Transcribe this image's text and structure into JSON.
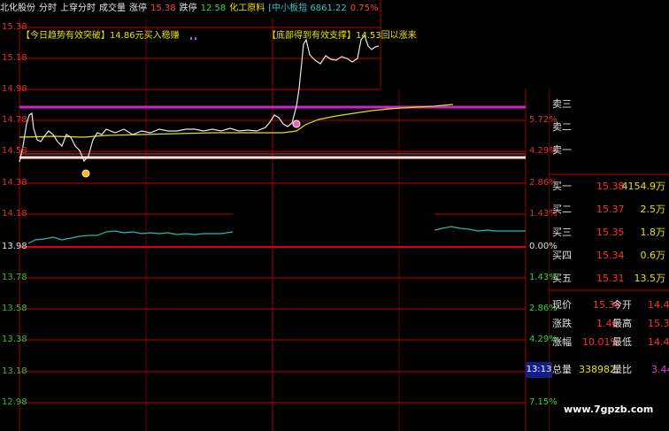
{
  "header": {
    "stock_name": "北化股份",
    "mode": "分时",
    "sub_mode": "上穿分时",
    "volume_label": "成交量",
    "limit_up_label": "涨停",
    "limit_up_value": "15.38",
    "limit_down_label": "跌停",
    "limit_down_value": "12.58",
    "sector_label": "化工原料",
    "index_text": "[中小板指 6861.22",
    "index_change": "0.75%]"
  },
  "annotations": {
    "left_note_tag": "【今日趋势有效突破】",
    "left_note_text": "14.86元买入稳赚",
    "right_note_tag": "【底部得到有效支撑】",
    "right_note_text": "14.53回以涨来"
  },
  "price_axis": {
    "left": [
      "15.38",
      "15.18",
      "14.98",
      "14.78",
      "14.58",
      "14.38",
      "14.18",
      "13.98",
      "13.78",
      "13.58",
      "13.38",
      "13.18",
      "12.98"
    ],
    "right_up": [
      "5.72%",
      "4.29%",
      "2.86%",
      "1.43%",
      "0.00%"
    ],
    "right_down": [
      "1.43%",
      "2.86%",
      "4.29%",
      "5.72%",
      "7.15%"
    ]
  },
  "time_marker": "13:13",
  "order_book": {
    "sell": [
      {
        "label": "卖三",
        "price": "",
        "qty": ""
      },
      {
        "label": "卖二",
        "price": "",
        "qty": ""
      },
      {
        "label": "卖一",
        "price": "",
        "qty": ""
      }
    ],
    "buy": [
      {
        "label": "买一",
        "price": "15.38",
        "qty": "4154.9万"
      },
      {
        "label": "买二",
        "price": "15.37",
        "qty": "2.5万"
      },
      {
        "label": "买三",
        "price": "15.35",
        "qty": "1.8万"
      },
      {
        "label": "买四",
        "price": "15.34",
        "qty": "0.6万"
      },
      {
        "label": "买五",
        "price": "15.31",
        "qty": "13.5万"
      }
    ]
  },
  "quote": {
    "current_label": "现价",
    "current_value": "15.38",
    "open_label": "今开",
    "open_value": "14.48",
    "change_label": "涨跌",
    "change_value": "1.40",
    "high_label": "最高",
    "high_value": "15.38",
    "pct_label": "涨幅",
    "pct_value": "10.01%",
    "low_label": "最低",
    "low_value": "14.40",
    "volume_label": "总量",
    "volume_value": "338982",
    "ratio_label": "量比",
    "ratio_value": "3.44"
  },
  "watermark": "www.7gpzb.com",
  "colors": {
    "price_line": "#e8e8e8",
    "avg_line": "#e8e000",
    "ma_line": "#28b8b8",
    "resistance": "#d020d0",
    "support": "#ffd0d0",
    "grid": "#b00000"
  }
}
